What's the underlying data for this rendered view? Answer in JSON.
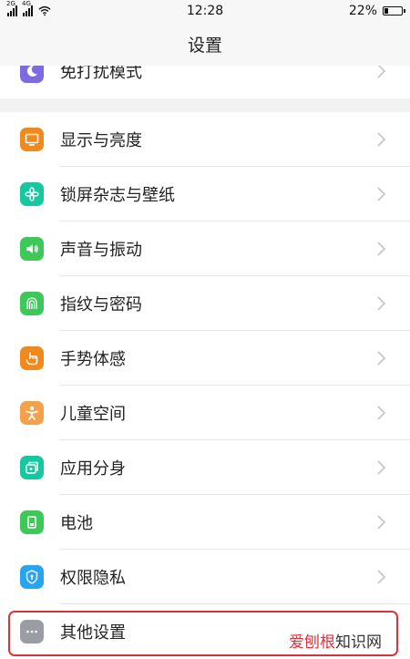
{
  "status_bar": {
    "sim1_tag": "2G",
    "sim2_tag": "4G",
    "time": "12:28",
    "battery": "22%",
    "battery_level": 0.22
  },
  "header": {
    "title": "设置"
  },
  "top_item": {
    "label": "免打扰模式",
    "icon": "moon-icon",
    "color": "#7e6be0"
  },
  "items": [
    {
      "label": "显示与亮度",
      "icon": "display-icon",
      "color": "#f08a1e"
    },
    {
      "label": "锁屏杂志与壁纸",
      "icon": "flower-icon",
      "color": "#17c7a0"
    },
    {
      "label": "声音与振动",
      "icon": "speaker-icon",
      "color": "#3fc85a"
    },
    {
      "label": "指纹与密码",
      "icon": "fingerprint-icon",
      "color": "#3fc85a"
    },
    {
      "label": "手势体感",
      "icon": "hand-icon",
      "color": "#f08a1e"
    },
    {
      "label": "儿童空间",
      "icon": "child-icon",
      "color": "#f5a04a"
    },
    {
      "label": "应用分身",
      "icon": "app-clone-icon",
      "color": "#17c7a0"
    },
    {
      "label": "电池",
      "icon": "battery-icon",
      "color": "#3fc85a"
    },
    {
      "label": "权限隐私",
      "icon": "shield-icon",
      "color": "#29a4f0"
    },
    {
      "label": "其他设置",
      "icon": "more-icon",
      "color": "#9a9da3"
    }
  ],
  "watermark": {
    "brand": "爱刨根",
    "rest": "知识网"
  }
}
